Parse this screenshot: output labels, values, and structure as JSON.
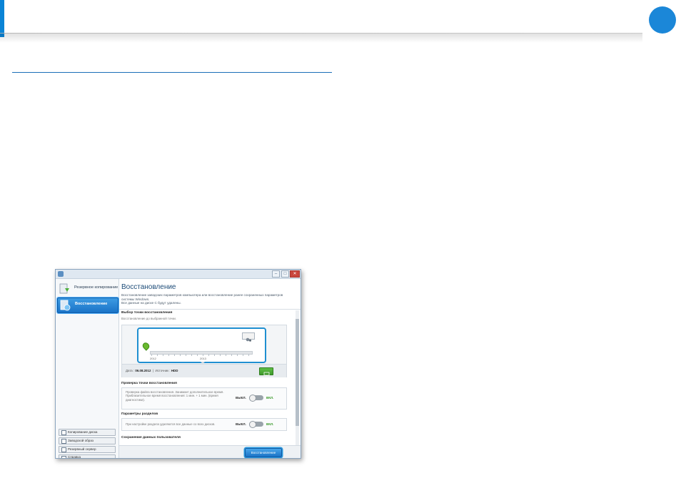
{
  "app": {
    "title": "Восстановление",
    "description": [
      "Восстановление заводских параметров компьютера или восстановление ранее сохраненных параметров",
      "системы Windows.",
      "Все данные на диске C будут удалены."
    ]
  },
  "sidebar": {
    "items": [
      {
        "label": "Резервное копирование",
        "icon": "backup-icon",
        "active": false
      },
      {
        "label": "Восстановление",
        "icon": "restore-icon",
        "active": true
      }
    ],
    "tools": [
      {
        "label": "Копирование диска",
        "icon": "disk-copy-icon"
      },
      {
        "label": "Заводской образ",
        "icon": "factory-image-icon"
      },
      {
        "label": "Резервный сервер",
        "icon": "backup-server-icon"
      },
      {
        "label": "Справка",
        "icon": "help-icon"
      }
    ]
  },
  "restore_point": {
    "title": "Выбор точки восстановления",
    "subtitle": "Восстановление до выбранной точки.",
    "years": [
      "2012",
      "2013"
    ],
    "date_label": "Дата :",
    "date_value": "06.08.2012",
    "separator": "|",
    "source_label": "Источник :",
    "source_value": "HDD"
  },
  "verification": {
    "title": "Проверка точки восстановления",
    "text": "Проверка файла восстановления. Занимает дополнительное время. Приблизительное время восстановления: 1 мин. + 1 мин. (время диагностики).",
    "off_label": "ВЫКЛ.",
    "on_label": "ВКЛ."
  },
  "partitions": {
    "title": "Параметры разделов",
    "text": "При настройке раздела удаляются все данные со всех дисков.",
    "off_label": "ВЫКЛ.",
    "on_label": "ВКЛ."
  },
  "user_data": {
    "title": "Сохранение данных пользователя"
  },
  "actions": {
    "restore_label": "Восстановление"
  },
  "colors": {
    "accent": "#0a84d6",
    "highlight": "#1f8fd1",
    "on_green": "#3a9a2a"
  }
}
